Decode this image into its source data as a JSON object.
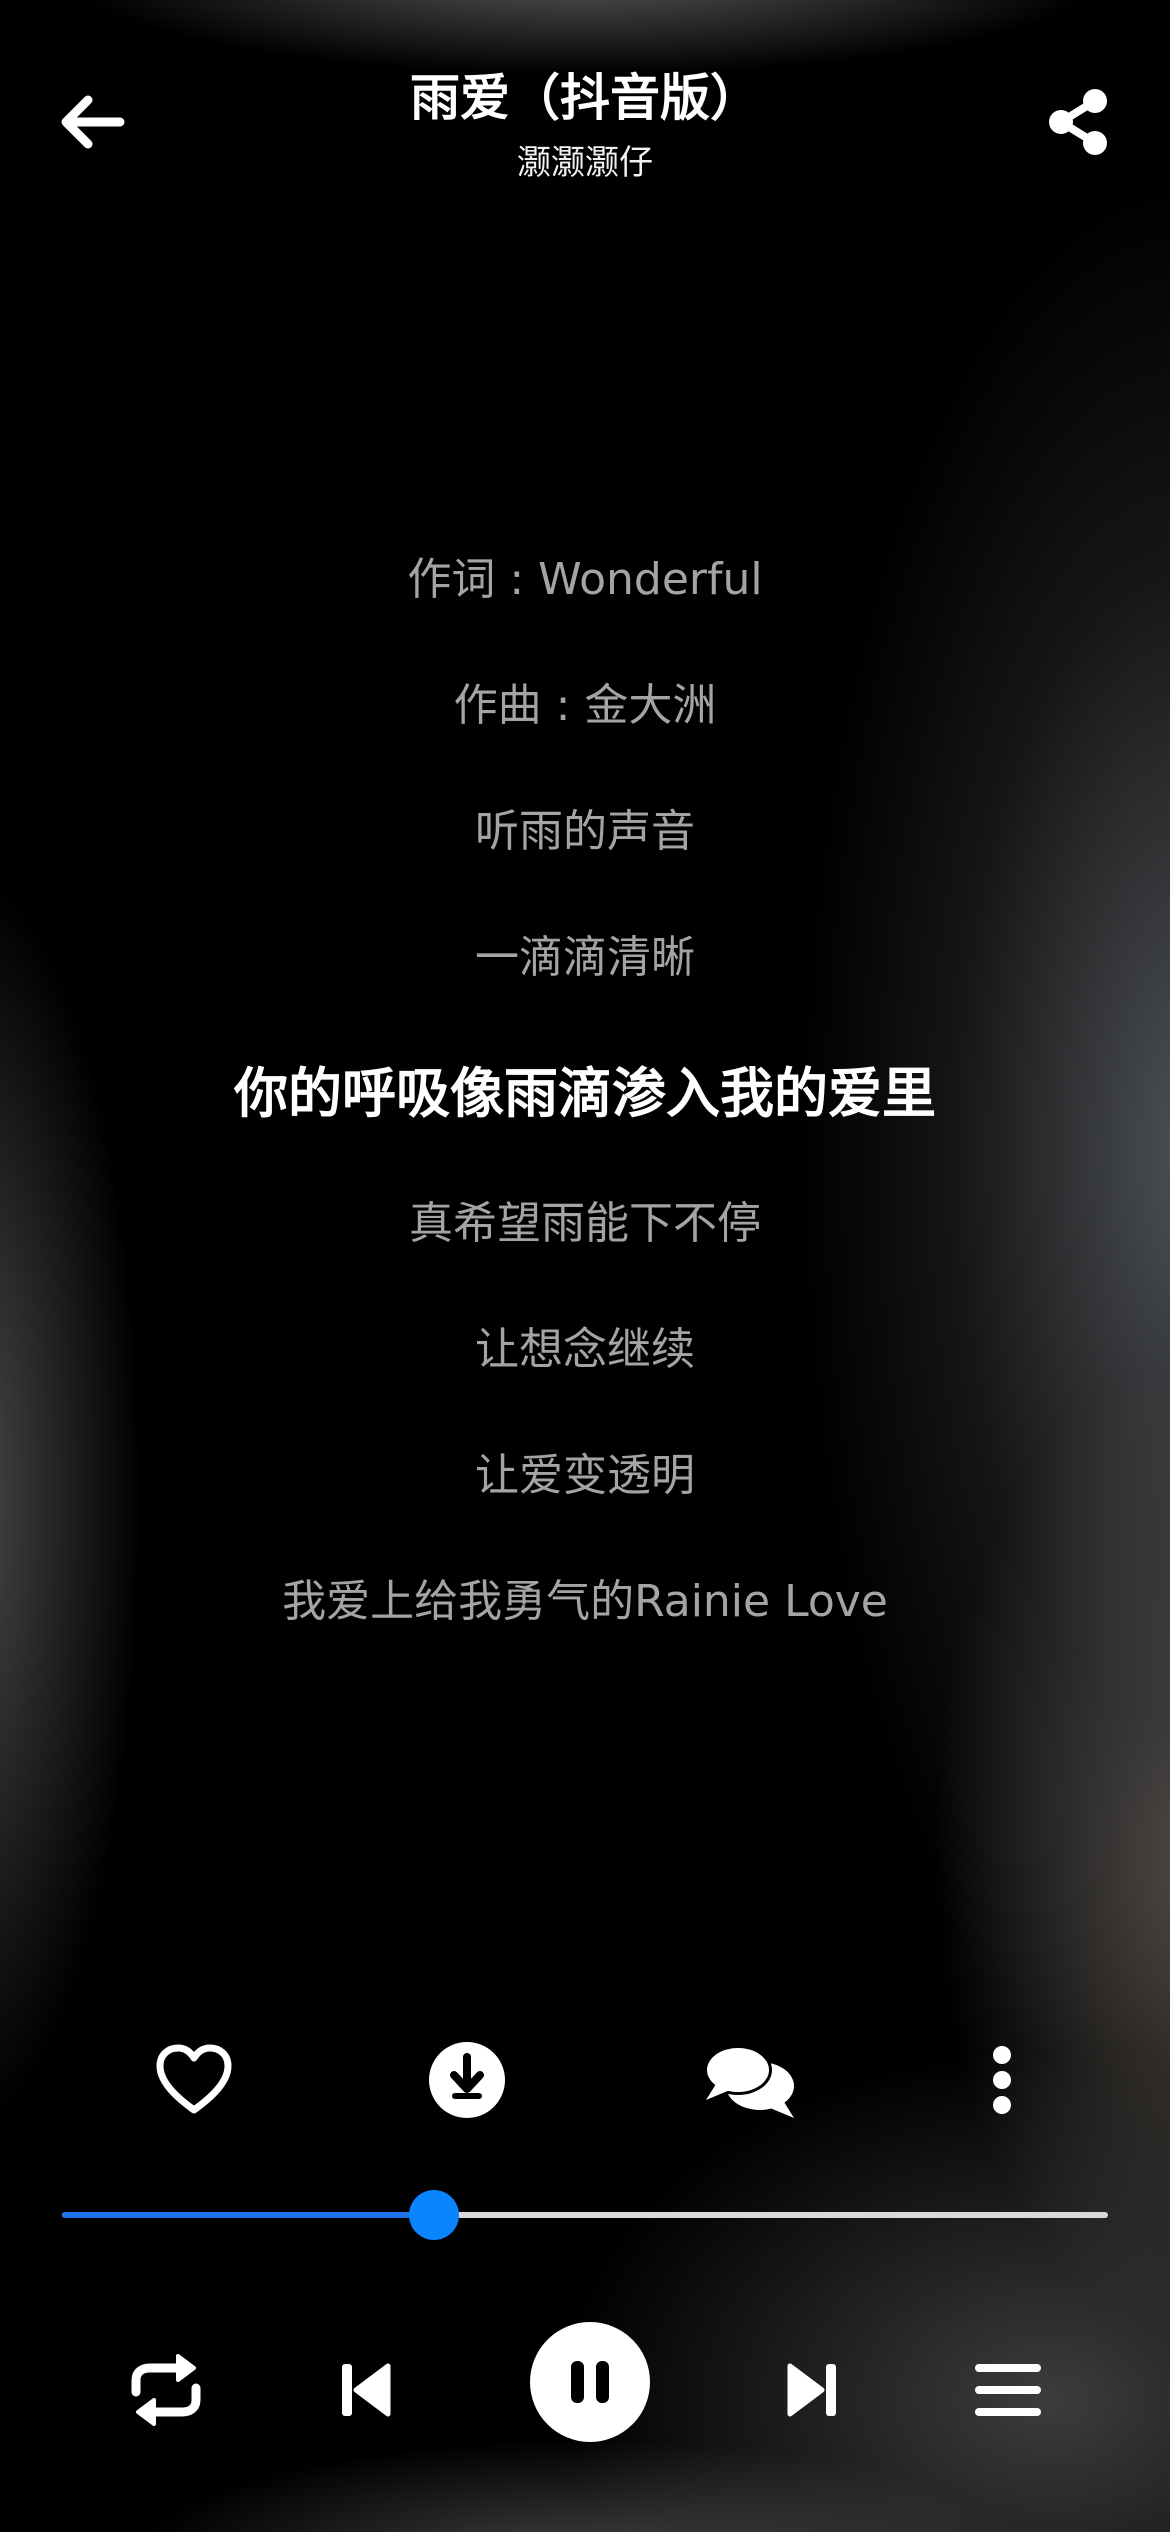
{
  "header": {
    "title": "雨爱（抖音版）",
    "artist": "灏灏灏仔",
    "back_icon": "arrow-left-icon",
    "share_icon": "share-icon"
  },
  "lyrics": [
    "作词 : Wonderful",
    "作曲 : 金大洲",
    "听雨的声音",
    "一滴滴清晰",
    "你的呼吸像雨滴渗入我的爱里",
    "真希望雨能下不停",
    "让想念继续",
    "让爱变透明",
    "我爱上给我勇气的Rainie Love"
  ],
  "active_lyric_index": 4,
  "actions": {
    "like_icon": "heart-icon",
    "download_icon": "download-icon",
    "comments_icon": "comments-icon",
    "more_icon": "more-vertical-icon"
  },
  "progress": {
    "fraction": 0.356,
    "played_color": "#1a73e8",
    "thumb_color": "#0a84ff",
    "track_color": "#d9d9d9"
  },
  "controls": {
    "repeat_icon": "repeat-icon",
    "previous_icon": "skip-previous-icon",
    "play_pause_icon": "pause-icon",
    "next_icon": "skip-next-icon",
    "playlist_icon": "playlist-icon"
  }
}
